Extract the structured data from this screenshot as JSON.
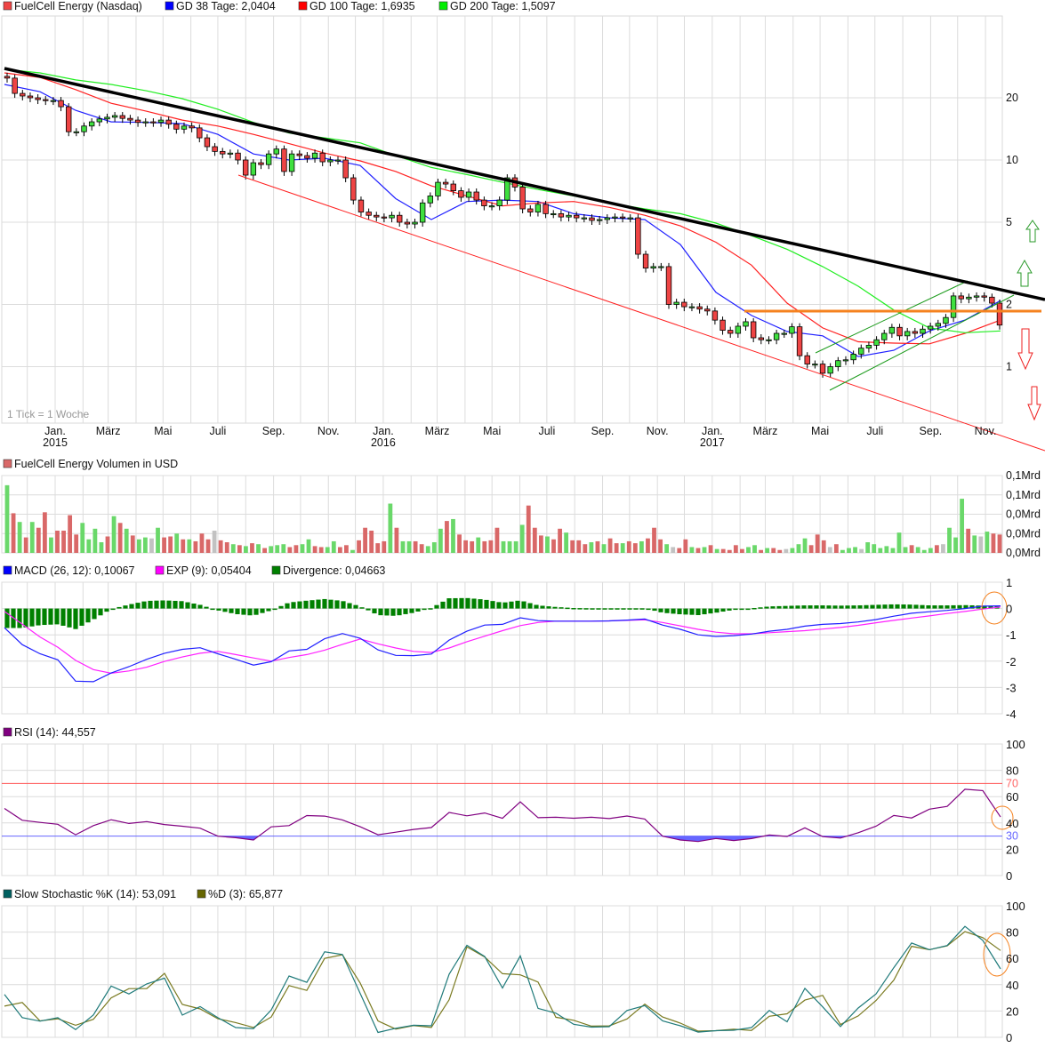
{
  "colors": {
    "up": "#3fe03f",
    "down": "#ee4444",
    "vol_up": "#6ad86a",
    "vol_down": "#d96868",
    "vol_flat": "#c2c2c2",
    "gd38": "#2020ff",
    "gd100": "#ff2020",
    "gd200": "#20ee20",
    "trend": "#000000",
    "channel": "#ff2020",
    "support": "#f5821f",
    "macd": "#2020ff",
    "exp": "#ff20ff",
    "divergence": "#008000",
    "rsi": "#800080",
    "rsi_upper": "#ff5555",
    "rsi_lower": "#6666ff",
    "stoch_k": "#1f7a7a",
    "stoch_d": "#7a7a20"
  },
  "legend": {
    "main": [
      {
        "label": "FuelCell Energy (Nasdaq)",
        "color": "#ee4444"
      },
      {
        "label": "GD 38 Tage: 2,0404",
        "color": "#0000ff"
      },
      {
        "label": "GD 100 Tage: 1,6935",
        "color": "#ff0000"
      },
      {
        "label": "GD 200 Tage: 1,5097",
        "color": "#00ee00"
      }
    ],
    "volume": [
      {
        "label": "FuelCell Energy Volumen in USD",
        "color": "#d96868"
      }
    ],
    "macd": [
      {
        "label": "MACD (26, 12): 0,10067",
        "color": "#0000ff"
      },
      {
        "label": "EXP (9): 0,05404",
        "color": "#ff00ff"
      },
      {
        "label": "Divergence: 0,04663",
        "color": "#008000"
      }
    ],
    "rsi": [
      {
        "label": "RSI (14): 44,557",
        "color": "#800080"
      }
    ],
    "stoch": [
      {
        "label": "Slow Stochastic %K (14): 53,091",
        "color": "#006060"
      },
      {
        "label": "%D (3): 65,877",
        "color": "#666600"
      }
    ]
  },
  "main_chart": {
    "note": "1 Tick = 1 Woche",
    "x_ticks": [
      "Jan.",
      "März",
      "Mai",
      "Juli",
      "Sep.",
      "Nov.",
      "Jan.",
      "März",
      "Mai",
      "Juli",
      "Sep.",
      "Nov.",
      "Jan.",
      "März",
      "Mai",
      "Juli",
      "Sep.",
      "Nov."
    ],
    "years": [
      "2015",
      "2016",
      "2017"
    ]
  },
  "chart_data": [
    {
      "type": "candlestick",
      "title": "FuelCell Energy (Nasdaq)",
      "y_scale": "log",
      "y_ticks": [
        {
          "value": 20,
          "label": "20"
        },
        {
          "value": 10,
          "label": "10"
        },
        {
          "value": 5,
          "label": "5"
        },
        {
          "value": 2,
          "label": "2"
        },
        {
          "value": 1,
          "label": "1"
        }
      ],
      "grid": true,
      "closes": [
        24.9,
        21.0,
        20.4,
        20.0,
        19.6,
        19.4,
        19.4,
        18.1,
        13.7,
        13.7,
        14.6,
        15.3,
        15.8,
        16.1,
        16.4,
        15.9,
        15.6,
        15.2,
        15.3,
        15.2,
        15.6,
        14.9,
        14.1,
        14.6,
        14.3,
        12.8,
        11.6,
        11.0,
        10.7,
        10.8,
        10.0,
        8.45,
        9.7,
        9.5,
        10.7,
        11.3,
        8.8,
        10.7,
        10.5,
        10.2,
        10.8,
        9.8,
        10.0,
        10.0,
        8.2,
        6.4,
        5.6,
        5.4,
        5.3,
        5.25,
        5.4,
        5.0,
        4.9,
        5.0,
        6.2,
        6.7,
        7.8,
        7.65,
        7.1,
        6.6,
        7.0,
        6.4,
        6.0,
        6.0,
        6.4,
        8.2,
        7.4,
        5.8,
        5.6,
        6.1,
        5.5,
        5.5,
        5.3,
        5.4,
        5.25,
        5.25,
        5.1,
        5.15,
        5.25,
        5.3,
        5.25,
        5.25,
        3.5,
        3.0,
        3.05,
        3.05,
        2.0,
        2.05,
        1.95,
        1.95,
        1.9,
        1.86,
        1.68,
        1.5,
        1.45,
        1.57,
        1.65,
        1.38,
        1.35,
        1.35,
        1.45,
        1.45,
        1.56,
        1.13,
        1.03,
        1.03,
        0.93,
        1.0,
        1.07,
        1.08,
        1.15,
        1.23,
        1.27,
        1.35,
        1.45,
        1.55,
        1.41,
        1.48,
        1.45,
        1.52,
        1.57,
        1.62,
        1.73,
        2.2,
        2.13,
        2.17,
        2.2,
        2.17,
        2.03,
        1.59
      ],
      "series": [
        {
          "name": "GD 38 Tage: 2,0404",
          "values": [
            23.2,
            21.4,
            17.4,
            15.3,
            15.2,
            15.0,
            13.3,
            10.7,
            10.0,
            10.2,
            9.4,
            6.5,
            5.15,
            6.3,
            6.4,
            6.3,
            5.5,
            5.25,
            5.15,
            3.9,
            2.29,
            1.77,
            1.48,
            1.41,
            1.12,
            1.2,
            1.49,
            1.68,
            2.09
          ]
        },
        {
          "name": "GD 100 Tage: 1,6935",
          "values": [
            26.4,
            25.1,
            21.9,
            18.8,
            17.2,
            15.6,
            14.6,
            13.3,
            12.0,
            10.8,
            9.9,
            8.8,
            7.5,
            6.7,
            6.0,
            6.2,
            6.3,
            5.9,
            5.4,
            4.8,
            4.0,
            3.1,
            2.03,
            1.54,
            1.32,
            1.3,
            1.29,
            1.45,
            1.68
          ]
        },
        {
          "name": "GD 200 Tage: 1,5097",
          "values": [
            27.5,
            26.4,
            24.4,
            23.2,
            21.6,
            19.8,
            17.6,
            15.2,
            13.5,
            12.8,
            12.1,
            10.5,
            9.2,
            8.5,
            7.8,
            7.2,
            6.7,
            6.2,
            5.8,
            5.5,
            4.95,
            4.3,
            3.7,
            3.05,
            2.45,
            1.88,
            1.54,
            1.46,
            1.49
          ]
        }
      ]
    },
    {
      "type": "bar",
      "title": "FuelCell Energy Volumen in USD",
      "y_ticks": [
        {
          "value": 0.08,
          "label": "0,1Mrd"
        },
        {
          "value": 0.06,
          "label": "0,1Mrd"
        },
        {
          "value": 0.04,
          "label": "0,0Mrd"
        },
        {
          "value": 0.02,
          "label": "0,0Mrd"
        },
        {
          "value": 0,
          "label": "0,0Mrd"
        }
      ],
      "values": [
        0.07,
        0.041,
        0.032,
        0.016,
        0.032,
        0.026,
        0.042,
        0.016,
        0.023,
        0.023,
        0.039,
        0.019,
        0.031,
        0.014,
        0.025,
        0.011,
        0.017,
        0.038,
        0.031,
        0.025,
        0.018,
        0.014,
        0.016,
        0.015,
        0.026,
        0.016,
        0.017,
        0.02,
        0.014,
        0.014,
        0.012,
        0.02,
        0.014,
        0.023,
        0.013,
        0.011,
        0.009,
        0.008,
        0.007,
        0.01,
        0.009,
        0.005,
        0.007,
        0.008,
        0.009,
        0.006,
        0.008,
        0.009,
        0.014,
        0.007,
        0.006,
        0.006,
        0.012,
        0.006,
        0.008,
        0.003,
        0.013,
        0.026,
        0.023,
        0.01,
        0.012,
        0.051,
        0.026,
        0.012,
        0.012,
        0.012,
        0.009,
        0.007,
        0.011,
        0.025,
        0.033,
        0.035,
        0.019,
        0.013,
        0.012,
        0.016,
        0.012,
        0.013,
        0.026,
        0.012,
        0.012,
        0.012,
        0.029,
        0.049,
        0.026,
        0.018,
        0.017,
        0.014,
        0.025,
        0.021,
        0.013,
        0.013,
        0.009,
        0.011,
        0.012,
        0.009,
        0.015,
        0.01,
        0.01,
        0.012,
        0.01,
        0.012,
        0.015,
        0.026,
        0.014,
        0.009,
        0.006,
        0.005,
        0.014,
        0.006,
        0.005,
        0.006,
        0.008,
        0.004,
        0.004,
        0.003,
        0.008,
        0.004,
        0.006,
        0.008,
        0.003,
        0.005,
        0.005,
        0.003,
        0.004,
        0.005,
        0.009,
        0.015,
        0.008,
        0.019,
        0.013,
        0.006,
        0.009,
        0.003,
        0.005,
        0.006,
        0.004,
        0.011,
        0.009,
        0.005,
        0.007,
        0.005,
        0.021,
        0.006,
        0.008,
        0.006,
        0.003,
        0.005,
        0.008,
        0.009,
        0.026,
        0.016,
        0.056,
        0.025,
        0.018,
        0.017,
        0.022,
        0.02,
        0.019
      ],
      "directions": [
        "u",
        "d",
        "u",
        "d",
        "u",
        "d",
        "d",
        "u",
        "d",
        "d",
        "d",
        "d",
        "u",
        "u",
        "u",
        "u",
        "d",
        "u",
        "d",
        "u",
        "d",
        "u",
        "u",
        "n",
        "u",
        "d",
        "d",
        "u",
        "d",
        "u",
        "d",
        "d",
        "d",
        "n",
        "d",
        "d",
        "u",
        "d",
        "u",
        "d",
        "u",
        "d",
        "u",
        "u",
        "u",
        "d",
        "d",
        "u",
        "u",
        "d",
        "d",
        "u",
        "u",
        "d",
        "d",
        "u",
        "d",
        "d",
        "d",
        "d",
        "d",
        "u",
        "d",
        "u",
        "u",
        "d",
        "d",
        "u",
        "u",
        "u",
        "d",
        "u",
        "d",
        "d",
        "d",
        "u",
        "d",
        "d",
        "d",
        "u",
        "u",
        "u",
        "u",
        "d",
        "d",
        "d",
        "u",
        "d",
        "d",
        "u",
        "d",
        "d",
        "d",
        "u",
        "d",
        "u",
        "d",
        "d",
        "u",
        "d",
        "d",
        "u",
        "d",
        "d",
        "d",
        "u",
        "n",
        "d",
        "d",
        "u",
        "d",
        "u",
        "d",
        "u",
        "d",
        "d",
        "d",
        "d",
        "u",
        "u",
        "d",
        "u",
        "d",
        "d",
        "n",
        "u",
        "u",
        "u",
        "d",
        "d",
        "d",
        "n",
        "d",
        "u",
        "u",
        "u",
        "n",
        "u",
        "u",
        "u",
        "u",
        "u",
        "u",
        "u",
        "d",
        "u",
        "u",
        "u",
        "d",
        "n",
        "u",
        "u",
        "u",
        "d",
        "u",
        "n",
        "u",
        "d",
        "d"
      ]
    },
    {
      "type": "line",
      "title": "MACD",
      "ylim": [
        -4,
        1
      ],
      "y_ticks": [
        "1",
        "0",
        "-1",
        "-2",
        "-3",
        "-4"
      ],
      "series": [
        {
          "name": "MACD (26, 12): 0,10067",
          "values": [
            -0.73,
            -1.37,
            -1.72,
            -1.95,
            -2.76,
            -2.78,
            -2.45,
            -2.21,
            -1.93,
            -1.7,
            -1.55,
            -1.49,
            -1.72,
            -1.93,
            -2.15,
            -2.02,
            -1.61,
            -1.55,
            -1.15,
            -0.95,
            -1.13,
            -1.57,
            -1.78,
            -1.79,
            -1.73,
            -1.2,
            -0.86,
            -0.63,
            -0.6,
            -0.35,
            -0.46,
            -0.48,
            -0.48,
            -0.48,
            -0.47,
            -0.44,
            -0.4,
            -0.63,
            -0.79,
            -1.0,
            -1.06,
            -1.03,
            -0.97,
            -0.86,
            -0.79,
            -0.67,
            -0.6,
            -0.57,
            -0.51,
            -0.42,
            -0.29,
            -0.18,
            -0.12,
            -0.07,
            0.0,
            0.09,
            0.1
          ]
        },
        {
          "name": "EXP (9): 0,05404",
          "values": [
            -0.11,
            -0.59,
            -1.08,
            -1.47,
            -1.97,
            -2.32,
            -2.46,
            -2.37,
            -2.23,
            -2.01,
            -1.84,
            -1.7,
            -1.63,
            -1.75,
            -1.88,
            -2.0,
            -1.86,
            -1.75,
            -1.58,
            -1.36,
            -1.16,
            -1.34,
            -1.5,
            -1.63,
            -1.67,
            -1.5,
            -1.26,
            -1.05,
            -0.84,
            -0.65,
            -0.53,
            -0.48,
            -0.48,
            -0.48,
            -0.47,
            -0.45,
            -0.43,
            -0.53,
            -0.66,
            -0.79,
            -0.9,
            -0.96,
            -0.96,
            -0.92,
            -0.88,
            -0.84,
            -0.78,
            -0.72,
            -0.64,
            -0.54,
            -0.45,
            -0.36,
            -0.28,
            -0.19,
            -0.11,
            -0.02,
            0.06
          ]
        },
        {
          "name": "Divergence: 0,04663",
          "type": "bar",
          "values": [
            -0.74,
            -0.74,
            -0.63,
            -0.6,
            -0.78,
            -0.42,
            -0.02,
            0.15,
            0.29,
            0.31,
            0.28,
            0.14,
            -0.07,
            -0.21,
            -0.27,
            -0.07,
            0.23,
            0.3,
            0.36,
            0.29,
            0.08,
            -0.25,
            -0.28,
            -0.16,
            0.02,
            0.39,
            0.4,
            0.34,
            0.22,
            0.31,
            0.12,
            0.06,
            0.02,
            0.01,
            0.01,
            0.01,
            0.01,
            -0.16,
            -0.22,
            -0.25,
            -0.16,
            -0.05,
            0.01,
            0.08,
            0.1,
            0.12,
            0.12,
            0.11,
            0.12,
            0.14,
            0.16,
            0.15,
            0.12,
            0.12,
            0.13,
            0.11,
            0.08
          ]
        }
      ]
    },
    {
      "type": "line",
      "title": "RSI (14): 44,557",
      "ylim": [
        0,
        100
      ],
      "y_ticks": [
        "100",
        "80",
        "60",
        "40",
        "20",
        "0"
      ],
      "reference_lines": [
        {
          "value": 70,
          "label": "70"
        },
        {
          "value": 30,
          "label": "30"
        }
      ],
      "series": [
        {
          "name": "RSI (14): 44,557",
          "values": [
            51,
            42,
            40.4,
            39,
            31,
            38,
            42.4,
            39.6,
            41,
            38.8,
            37.5,
            36,
            29.9,
            28.8,
            27,
            37,
            38,
            45.6,
            45.2,
            42.3,
            37.1,
            31,
            33,
            35.1,
            36.5,
            48,
            45.4,
            47.6,
            43.5,
            56,
            44,
            44.3,
            43.6,
            44.3,
            43.3,
            45.3,
            43,
            29.9,
            27,
            25.9,
            28.2,
            26.6,
            28.1,
            30.8,
            29.7,
            36.3,
            29.6,
            28.5,
            32.6,
            37.5,
            45.7,
            43.8,
            50.5,
            52.6,
            65.6,
            64.6,
            44.5
          ]
        }
      ]
    },
    {
      "type": "line",
      "title": "Slow Stochastic",
      "ylim": [
        0,
        100
      ],
      "y_ticks": [
        "100",
        "80",
        "60",
        "40",
        "20",
        "0"
      ],
      "series": [
        {
          "name": "Slow Stochastic %K (14): 53,091",
          "values": [
            32.6,
            15,
            12.3,
            14.9,
            5.9,
            17,
            39,
            33,
            40.6,
            45,
            16.9,
            23.4,
            14.9,
            7.4,
            6.6,
            20.8,
            46.6,
            41.8,
            65,
            63,
            33.4,
            3.7,
            6.9,
            9.2,
            8.8,
            48,
            70,
            61.4,
            37.5,
            61.9,
            22,
            18.4,
            9.9,
            7.8,
            8.1,
            20.4,
            24.1,
            12.6,
            8.8,
            4,
            5.1,
            5.4,
            7.4,
            20.4,
            11.8,
            37.2,
            23.2,
            8.2,
            22.3,
            33,
            53,
            71.7,
            66.6,
            69.8,
            84.3,
            73.7,
            52
          ]
        },
        {
          "name": "%D (3): 65,877",
          "values": [
            23.7,
            26.5,
            12.5,
            14.1,
            9.2,
            13.7,
            30,
            37,
            37.1,
            48.6,
            25,
            21.6,
            14.1,
            11.2,
            7.5,
            15.5,
            39.3,
            35.7,
            60,
            62.8,
            41.3,
            12.5,
            6.3,
            8.9,
            7.5,
            28.5,
            68.8,
            61.1,
            48.4,
            47.5,
            42,
            15.3,
            13,
            8.5,
            8.7,
            14,
            25.3,
            15.5,
            10.8,
            4.7,
            5.1,
            6.2,
            5.3,
            16,
            17.9,
            28.3,
            31.9,
            9.7,
            16.3,
            28,
            43.5,
            69.2,
            66.6,
            69.5,
            80.4,
            75.8,
            66
          ]
        }
      ]
    }
  ]
}
